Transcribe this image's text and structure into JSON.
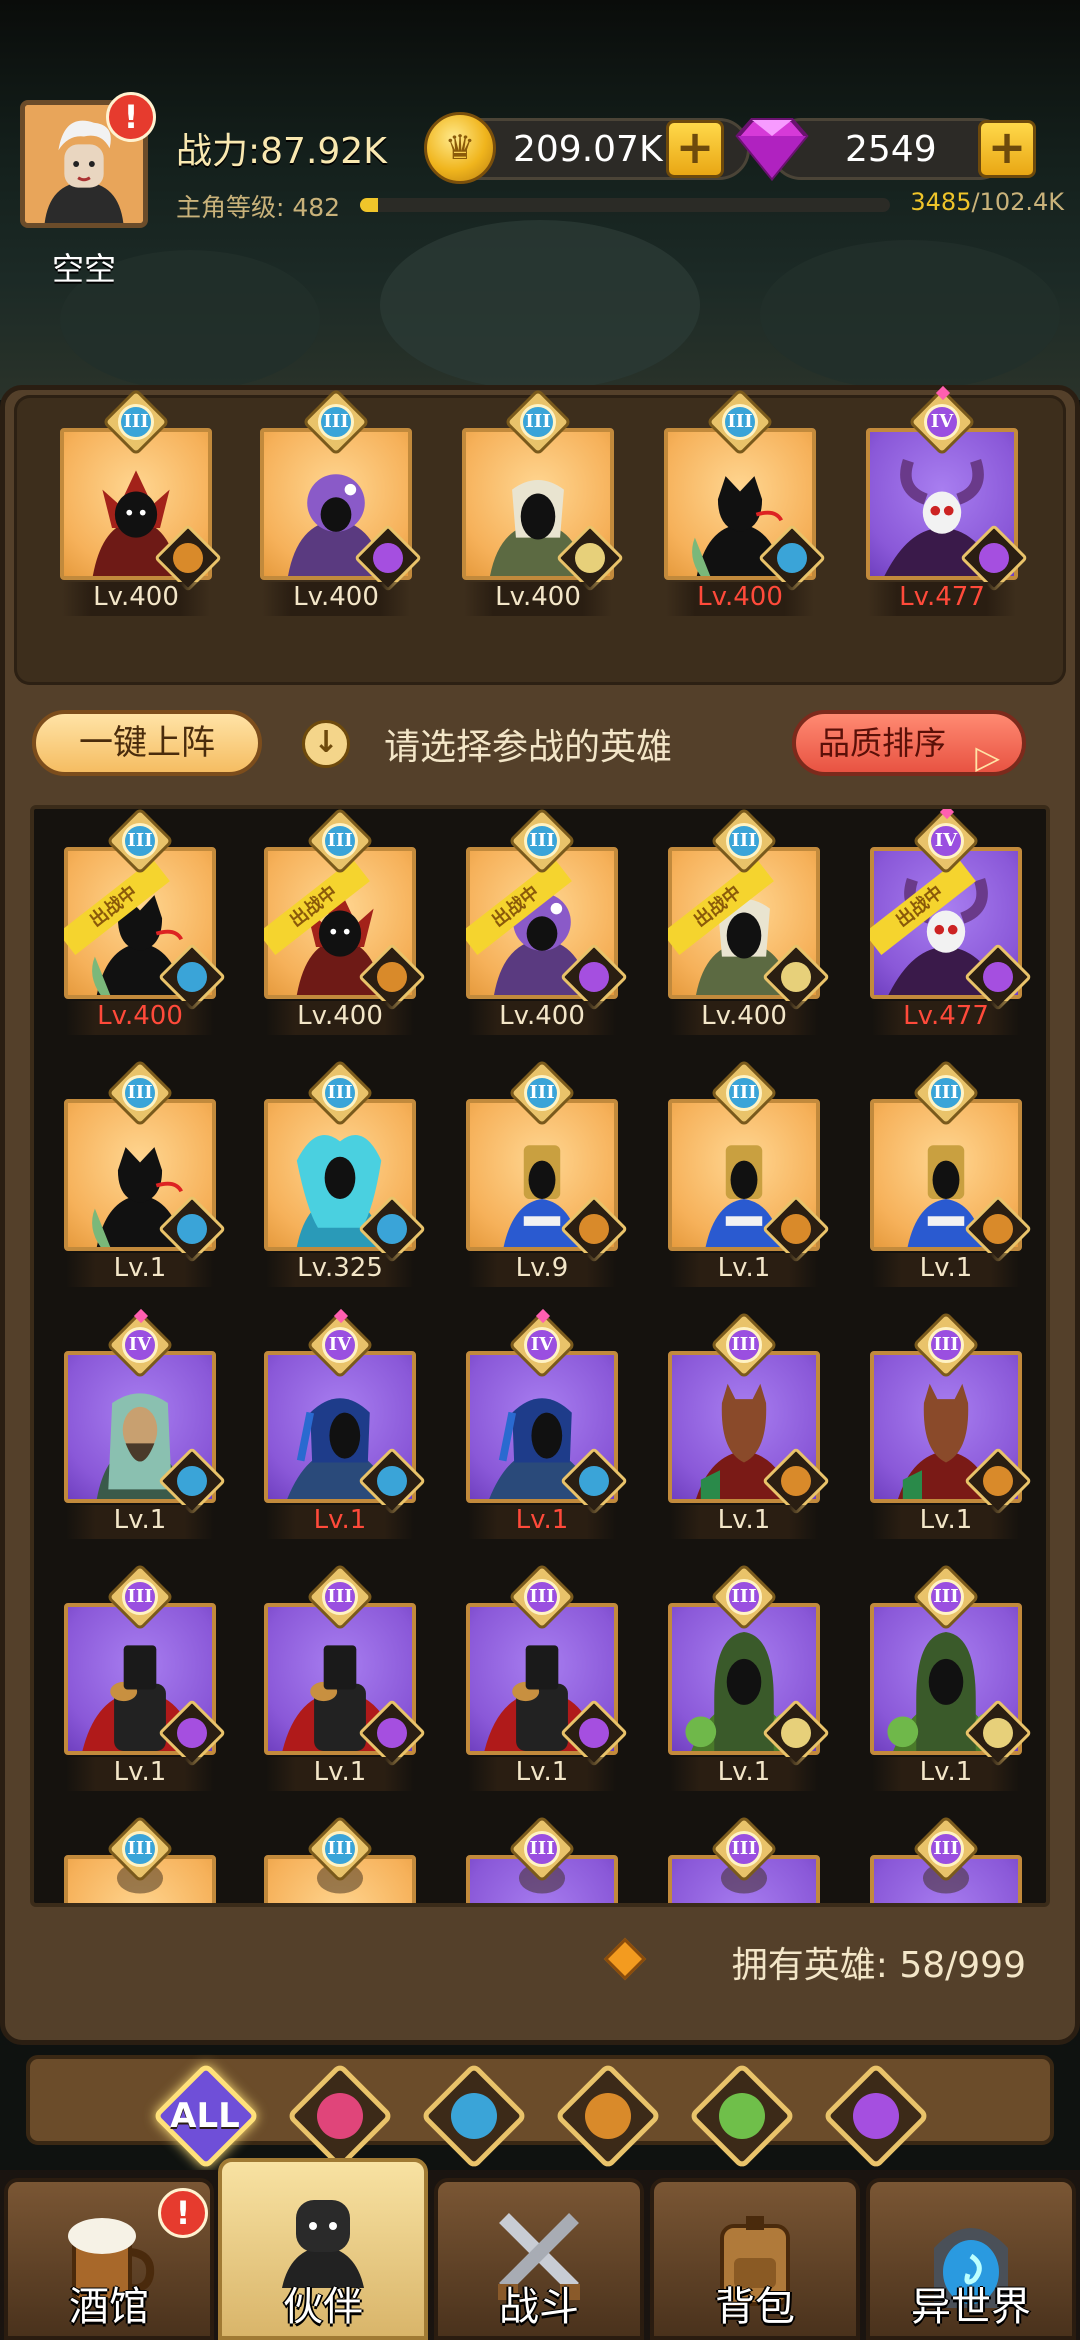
{
  "header": {
    "player_name": "空空",
    "power": "战力:87.92K",
    "level_label": "主角等级: 482",
    "exp_current": "3485",
    "exp_total": "/102.4K",
    "exp_fraction": 0.034,
    "gold": "209.07K",
    "gems": "2549",
    "alert": "!"
  },
  "lineup": [
    {
      "tier": "III",
      "level": "Lv.400",
      "level_red": false,
      "bg": "orange",
      "faction": "lion",
      "hero": "dark-red-warrior"
    },
    {
      "tier": "III",
      "level": "Lv.400",
      "level_red": false,
      "bg": "orange",
      "faction": "demon",
      "hero": "purple-orc"
    },
    {
      "tier": "III",
      "level": "Lv.400",
      "level_red": false,
      "bg": "orange",
      "faction": "elf",
      "hero": "dark-elf"
    },
    {
      "tier": "III",
      "level": "Lv.400",
      "level_red": true,
      "bg": "orange",
      "faction": "fishman",
      "hero": "shadow-lizard"
    },
    {
      "tier": "IV",
      "level": "Lv.477",
      "level_red": true,
      "bg": "purple",
      "faction": "demon",
      "hero": "horned-skull"
    }
  ],
  "controls": {
    "auto_deploy": "一键上阵",
    "hint": "请选择参战的英雄",
    "sort": "品质排序"
  },
  "roster": [
    {
      "tier": "III",
      "level": "Lv.400",
      "level_red": true,
      "bg": "orange",
      "faction": "fishman",
      "deployed": "出战中",
      "hero": "shadow-lizard"
    },
    {
      "tier": "III",
      "level": "Lv.400",
      "level_red": false,
      "bg": "orange",
      "faction": "lion",
      "deployed": "出战中",
      "hero": "dark-red-warrior"
    },
    {
      "tier": "III",
      "level": "Lv.400",
      "level_red": false,
      "bg": "orange",
      "faction": "demon",
      "deployed": "出战中",
      "hero": "purple-orc"
    },
    {
      "tier": "III",
      "level": "Lv.400",
      "level_red": false,
      "bg": "orange",
      "faction": "elf",
      "deployed": "出战中",
      "hero": "dark-elf"
    },
    {
      "tier": "IV",
      "level": "Lv.477",
      "level_red": true,
      "bg": "purple",
      "faction": "demon",
      "deployed": "出战中",
      "hero": "horned-skull"
    },
    {
      "tier": "III",
      "level": "Lv.1",
      "level_red": false,
      "bg": "orange",
      "faction": "fishman",
      "deployed": "",
      "hero": "shadow-lizard"
    },
    {
      "tier": "III",
      "level": "Lv.325",
      "level_red": false,
      "bg": "orange",
      "faction": "fishman",
      "deployed": "",
      "hero": "cyan-mermaid"
    },
    {
      "tier": "III",
      "level": "Lv.9",
      "level_red": false,
      "bg": "orange",
      "faction": "lion",
      "deployed": "",
      "hero": "pharaoh"
    },
    {
      "tier": "III",
      "level": "Lv.1",
      "level_red": false,
      "bg": "orange",
      "faction": "lion",
      "deployed": "",
      "hero": "pharaoh"
    },
    {
      "tier": "III",
      "level": "Lv.1",
      "level_red": false,
      "bg": "orange",
      "faction": "lion",
      "deployed": "",
      "hero": "pharaoh"
    },
    {
      "tier": "IV",
      "level": "Lv.1",
      "level_red": false,
      "bg": "purple",
      "faction": "fishman",
      "deployed": "",
      "hero": "bearded-sage"
    },
    {
      "tier": "IV",
      "level": "Lv.1",
      "level_red": true,
      "bg": "purple",
      "faction": "fishman",
      "deployed": "",
      "hero": "blue-hood"
    },
    {
      "tier": "IV",
      "level": "Lv.1",
      "level_red": true,
      "bg": "purple",
      "faction": "fishman",
      "deployed": "",
      "hero": "blue-hood"
    },
    {
      "tier": "III",
      "level": "Lv.1",
      "level_red": false,
      "bg": "purple",
      "faction": "lion",
      "deployed": "",
      "hero": "horse-head"
    },
    {
      "tier": "III",
      "level": "Lv.1",
      "level_red": false,
      "bg": "purple",
      "faction": "lion",
      "deployed": "",
      "hero": "horse-head"
    },
    {
      "tier": "III",
      "level": "Lv.1",
      "level_red": false,
      "bg": "purple",
      "faction": "demon",
      "deployed": "",
      "hero": "caped-knight"
    },
    {
      "tier": "III",
      "level": "Lv.1",
      "level_red": false,
      "bg": "purple",
      "faction": "demon",
      "deployed": "",
      "hero": "caped-knight"
    },
    {
      "tier": "III",
      "level": "Lv.1",
      "level_red": false,
      "bg": "purple",
      "faction": "demon",
      "deployed": "",
      "hero": "caped-knight"
    },
    {
      "tier": "III",
      "level": "Lv.1",
      "level_red": false,
      "bg": "purple",
      "faction": "elf",
      "deployed": "",
      "hero": "green-hood"
    },
    {
      "tier": "III",
      "level": "Lv.1",
      "level_red": false,
      "bg": "purple",
      "faction": "elf",
      "deployed": "",
      "hero": "green-hood"
    },
    {
      "tier": "III",
      "level": "",
      "level_red": false,
      "bg": "orange",
      "faction": "",
      "deployed": "",
      "hero": "partial"
    },
    {
      "tier": "III",
      "level": "",
      "level_red": false,
      "bg": "orange",
      "faction": "",
      "deployed": "",
      "hero": "partial"
    },
    {
      "tier": "III",
      "level": "",
      "level_red": false,
      "bg": "purple",
      "faction": "",
      "deployed": "",
      "hero": "partial"
    },
    {
      "tier": "III",
      "level": "",
      "level_red": false,
      "bg": "purple",
      "faction": "",
      "deployed": "",
      "hero": "partial"
    },
    {
      "tier": "III",
      "level": "",
      "level_red": false,
      "bg": "purple",
      "faction": "",
      "deployed": "",
      "hero": "partial"
    }
  ],
  "owned": "拥有英雄: 58/999",
  "faction_tabs": [
    {
      "label": "ALL",
      "icon": "all-icon",
      "color": "#6f4fd8",
      "active": true
    },
    {
      "label": "",
      "icon": "helmet-faction-icon",
      "color": "#e0457a",
      "active": false
    },
    {
      "label": "",
      "icon": "fishman-faction-icon",
      "color": "#3aa4d8",
      "active": false
    },
    {
      "label": "",
      "icon": "lion-faction-icon",
      "color": "#d98a2a",
      "active": false
    },
    {
      "label": "",
      "icon": "elf-faction-icon",
      "color": "#6fbf4a",
      "active": false
    },
    {
      "label": "",
      "icon": "demon-faction-icon",
      "color": "#a54fe0",
      "active": false
    }
  ],
  "nav": [
    {
      "label": "酒馆",
      "icon": "tavern-mug-icon",
      "active": false,
      "alert": "!"
    },
    {
      "label": "伙伴",
      "icon": "partner-icon",
      "active": true,
      "alert": ""
    },
    {
      "label": "战斗",
      "icon": "crossed-swords-icon",
      "active": false,
      "alert": ""
    },
    {
      "label": "背包",
      "icon": "backpack-icon",
      "active": false,
      "alert": ""
    },
    {
      "label": "异世界",
      "icon": "portal-icon",
      "active": false,
      "alert": ""
    }
  ],
  "colors": {
    "faction_lion": "#d98a2a",
    "faction_demon": "#a54fe0",
    "faction_elf": "#e7d07a",
    "faction_fishman": "#3aa4d8"
  }
}
